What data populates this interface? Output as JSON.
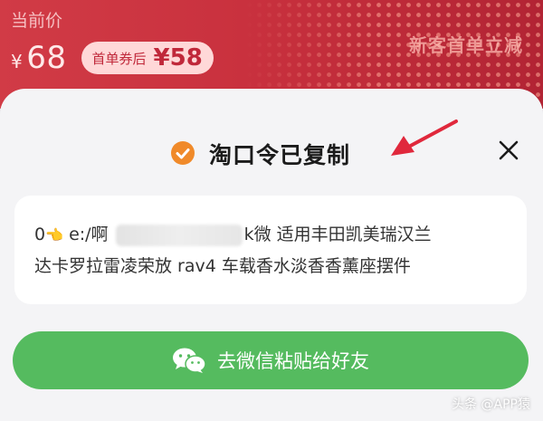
{
  "banner": {
    "price_title": "当前价",
    "currency": "¥",
    "price": "68",
    "coupon_label": "首单券后",
    "coupon_price": "¥58",
    "new_user_text": "新客首单立减"
  },
  "dialog": {
    "title": "淘口令已复制",
    "code_line1_prefix": "0",
    "code_line1_mid": "e:/啊",
    "code_line1_suffix": "k微  适用丰田凯美瑞汉兰",
    "code_line2": "达卡罗拉雷凌荣放 rav4 车载香水淡香香薰座摆件",
    "share_label": "去微信粘贴给好友"
  },
  "watermark": "头条 @APP猿",
  "colors": {
    "accent_green": "#55bb5f",
    "banner_red": "#c9313e",
    "check_orange": "#f08a2a",
    "arrow_red": "#e0283c"
  },
  "icons": {
    "check": "check-circle-icon",
    "close": "close-icon",
    "wechat": "wechat-icon",
    "hand": "pointing-hand-icon"
  }
}
